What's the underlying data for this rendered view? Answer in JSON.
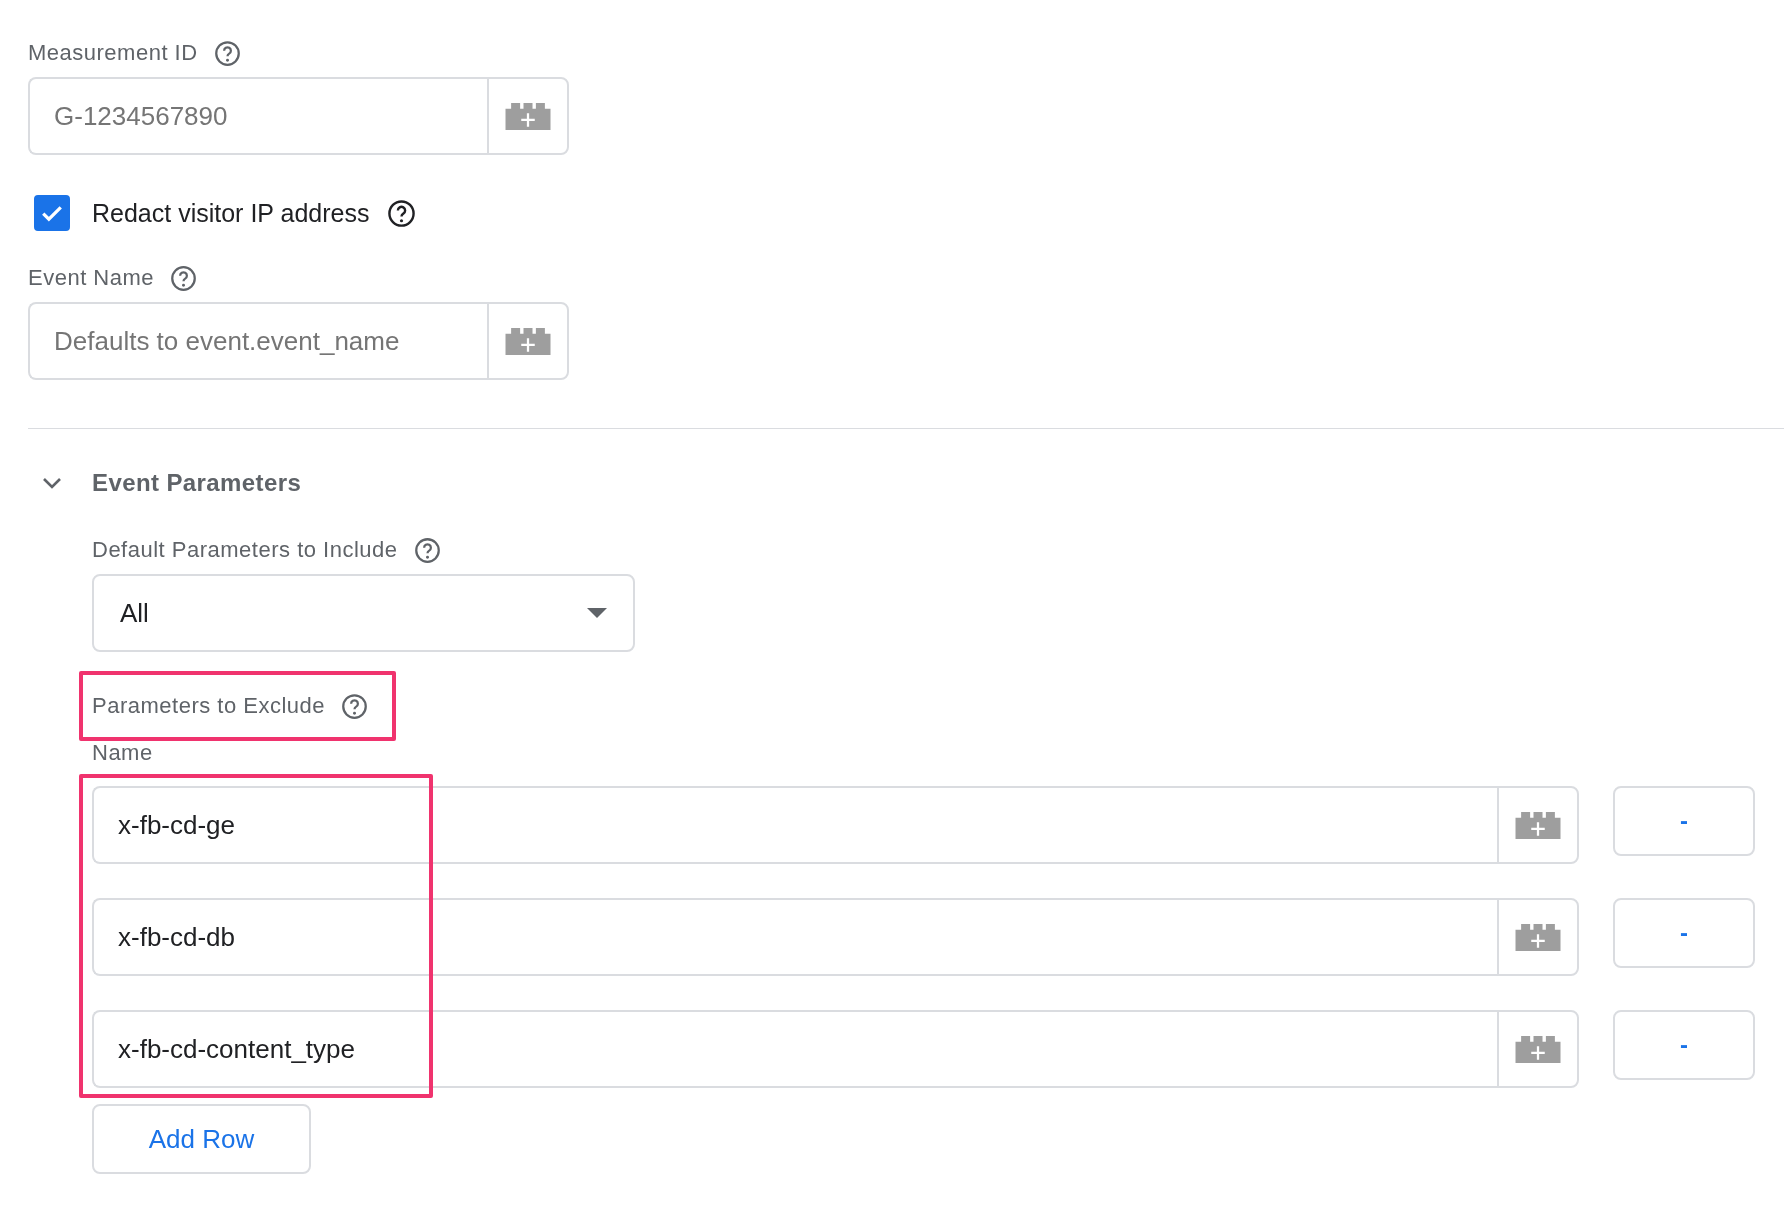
{
  "measurement_id": {
    "label": "Measurement ID",
    "placeholder": "G-1234567890"
  },
  "redact_ip": {
    "label": "Redact visitor IP address",
    "checked": true
  },
  "event_name": {
    "label": "Event Name",
    "placeholder": "Defaults to event.event_name"
  },
  "event_parameters": {
    "title": "Event Parameters",
    "expanded": true,
    "default_params": {
      "label": "Default Parameters to Include",
      "value": "All"
    },
    "exclude": {
      "label": "Parameters to Exclude",
      "highlighted": true,
      "column": "Name",
      "rows_highlighted": true,
      "rows": [
        {
          "value": "x-fb-cd-ge",
          "remove": "-"
        },
        {
          "value": "x-fb-cd-db",
          "remove": "-"
        },
        {
          "value": "x-fb-cd-content_type",
          "remove": "-"
        }
      ],
      "add_button": "Add Row"
    }
  }
}
